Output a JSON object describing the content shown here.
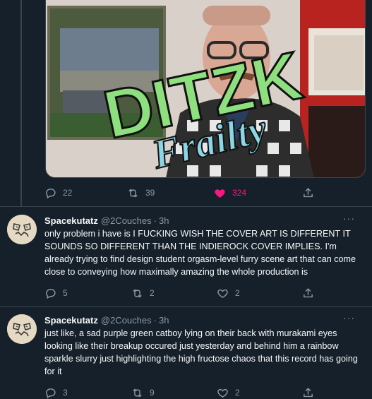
{
  "media": {
    "cover_text_main": "DITZK",
    "cover_text_sub": "Frailty"
  },
  "top_tweet": {
    "replies": "22",
    "retweets": "39",
    "likes": "324"
  },
  "tweets": [
    {
      "name": "Spacekutatz",
      "handle": "@2Couches",
      "separator": "·",
      "time": "3h",
      "more": "···",
      "text": "only problem i have is I FUCKING WISH THE COVER ART IS DIFFERENT IT SOUNDS SO DIFFERENT THAN THE INDIEROCK COVER IMPLIES. I'm already trying to find design student orgasm-level furry scene art that can come close to conveying how maximally amazing the whole production is",
      "replies": "5",
      "retweets": "2",
      "likes": "2"
    },
    {
      "name": "Spacekutatz",
      "handle": "@2Couches",
      "separator": "·",
      "time": "3h",
      "more": "···",
      "text": "just like, a sad purple green catboy lying on their back with murakami eyes looking like their breakup occured just yesterday and behind him a rainbow sparkle slurry just highlighting the high fructose chaos that this record has going for it",
      "replies": "3",
      "retweets": "9",
      "likes": "2"
    }
  ],
  "colors": {
    "background": "#15202b",
    "border": "#38444d",
    "secondary_text": "#8b98a5",
    "like_pink": "#f91880"
  },
  "icons": [
    "reply-icon",
    "retweet-icon",
    "like-icon",
    "share-icon",
    "more-icon"
  ]
}
